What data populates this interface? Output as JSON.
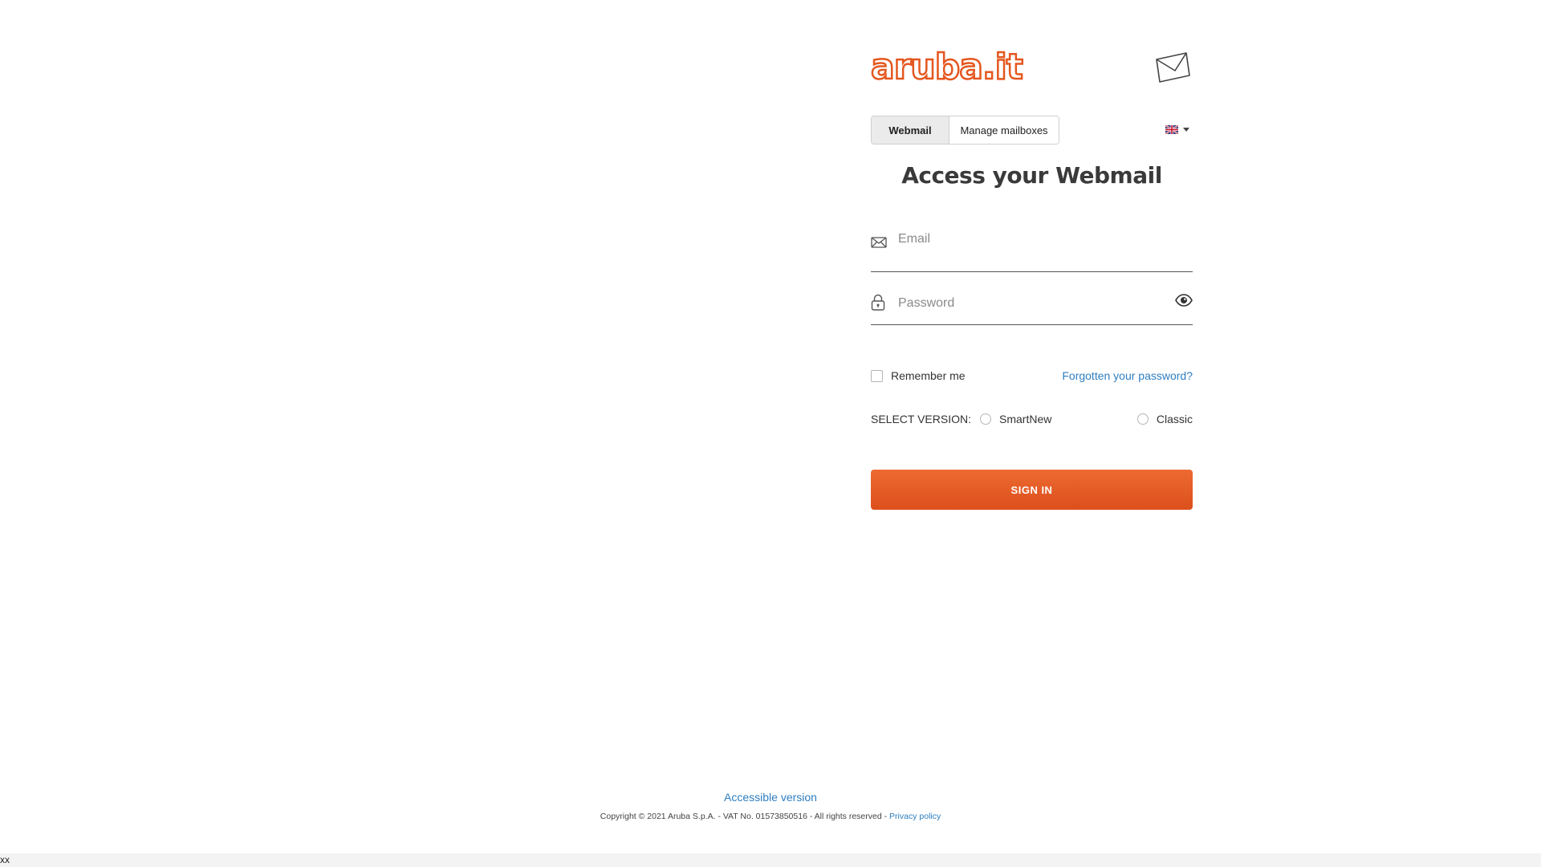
{
  "brand": {
    "logo_text": "aruba.it",
    "accent_color": "#e4571f",
    "link_color": "#2e7ec1"
  },
  "tabs": [
    {
      "label": "Webmail",
      "active": true
    },
    {
      "label": "Manage mailboxes",
      "active": false
    }
  ],
  "language": {
    "flag_icon": "uk-flag-icon",
    "dropdown_icon": "caret-down-icon"
  },
  "title": "Access your Webmail",
  "form": {
    "email": {
      "placeholder": "Email",
      "value": "",
      "icon": "envelope-icon"
    },
    "password": {
      "placeholder": "Password",
      "value": "",
      "icon": "lock-icon",
      "toggle_icon": "eye-icon"
    },
    "remember_label": "Remember me",
    "remember_checked": false,
    "forgot_label": "Forgotten your password?",
    "version_label": "SELECT VERSION:",
    "versions": [
      {
        "label": "SmartNew",
        "selected": false
      },
      {
        "label": "Classic",
        "selected": false
      }
    ],
    "submit_label": "SIGN IN"
  },
  "footer": {
    "accessible_label": "Accessible version",
    "copyright": "Copyright © 2021 Aruba S.p.A. - VAT No. 01573850516 - All rights reserved - ",
    "privacy_label": "Privacy policy"
  },
  "bottom_bar_text": "xx"
}
